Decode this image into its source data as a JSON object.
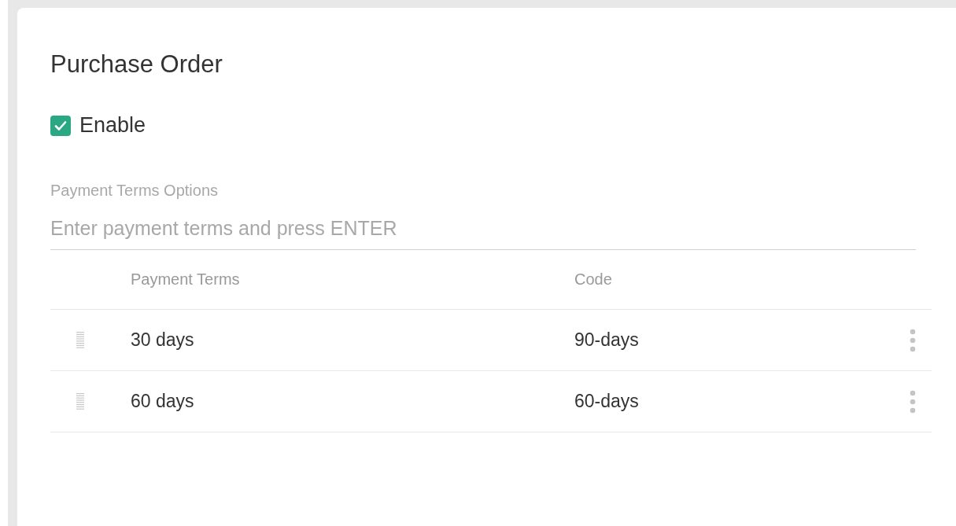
{
  "title": "Purchase Order",
  "enable": {
    "label": "Enable",
    "checked": true
  },
  "payment_terms_field": {
    "label": "Payment Terms Options",
    "placeholder": "Enter payment terms and press ENTER"
  },
  "table": {
    "columns": [
      "Payment Terms",
      "Code"
    ],
    "rows": [
      {
        "payment_terms": "30 days",
        "code": "90-days"
      },
      {
        "payment_terms": "60 days",
        "code": "60-days"
      }
    ]
  }
}
